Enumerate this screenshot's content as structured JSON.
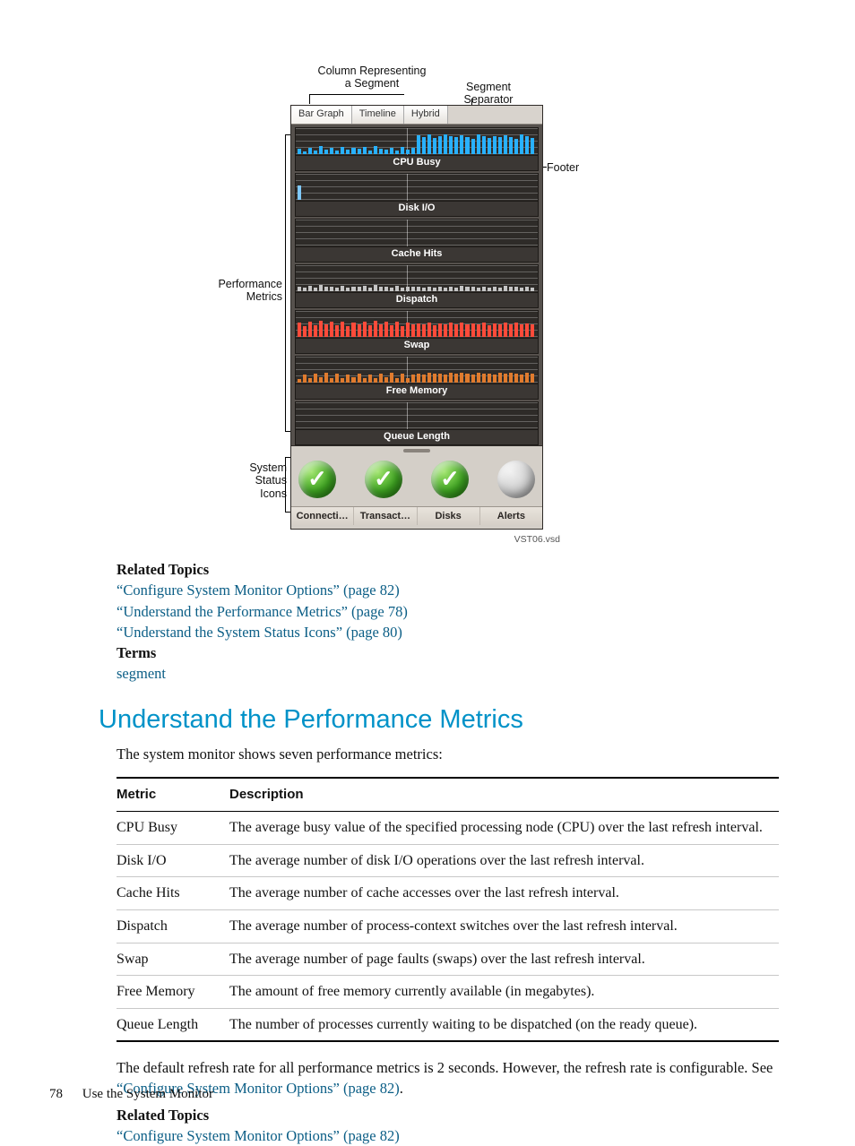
{
  "figure": {
    "labels": {
      "column_segment": "Column Representing\na Segment",
      "segment_separator": "Segment\nSeparator",
      "footer": "Footer",
      "performance_metrics": "Performance\nMetrics",
      "system_status_icons": "System\nStatus\nIcons",
      "vsd": "VST06.vsd"
    },
    "tabs": [
      "Bar Graph",
      "Timeline",
      "Hybrid"
    ],
    "metrics": [
      {
        "name": "CPU Busy",
        "color": "#29b1ff"
      },
      {
        "name": "Disk I/O",
        "color": "#7fc9ff"
      },
      {
        "name": "Cache Hits",
        "color": "#262626"
      },
      {
        "name": "Dispatch",
        "color": "#c6c6c6"
      },
      {
        "name": "Swap",
        "color": "#ff4b3a"
      },
      {
        "name": "Free Memory",
        "color": "#e07b2e"
      },
      {
        "name": "Queue Length",
        "color": "#262626"
      }
    ],
    "status": {
      "items": [
        {
          "label": "Connecti…",
          "state": "ok"
        },
        {
          "label": "Transact…",
          "state": "ok"
        },
        {
          "label": "Disks",
          "state": "ok"
        },
        {
          "label": "Alerts",
          "state": "idle"
        }
      ]
    }
  },
  "related1": {
    "heading": "Related Topics",
    "items": [
      "“Configure System Monitor Options” (page 82)",
      "“Understand the Performance Metrics” (page 78)",
      "“Understand the System Status Icons” (page 80)"
    ],
    "terms_heading": "Terms",
    "terms_link": "segment"
  },
  "section": {
    "title": "Understand the Performance Metrics",
    "intro": "The system monitor shows seven performance metrics:",
    "table": {
      "head": [
        "Metric",
        "Description"
      ],
      "rows": [
        [
          "CPU Busy",
          "The average busy value of the specified processing node (CPU) over the last refresh interval."
        ],
        [
          "Disk I/O",
          "The average number of disk I/O operations over the last refresh interval."
        ],
        [
          "Cache Hits",
          "The average number of cache accesses over the last refresh interval."
        ],
        [
          "Dispatch",
          "The average number of process-context switches over the last refresh interval."
        ],
        [
          "Swap",
          "The average number of page faults (swaps) over the last refresh interval."
        ],
        [
          "Free Memory",
          "The amount of free memory currently available (in megabytes)."
        ],
        [
          "Queue Length",
          "The number of processes currently waiting to be dispatched (on the ready queue)."
        ]
      ]
    },
    "paragraph_pre": "The default refresh rate for all performance metrics is 2 seconds. However, the refresh rate is configurable. See ",
    "paragraph_link": "“Configure System Monitor Options” (page 82)",
    "paragraph_post": "."
  },
  "related2": {
    "heading": "Related Topics",
    "items": [
      "“Configure System Monitor Options” (page 82)"
    ]
  },
  "footer": {
    "page": "78",
    "chapter": "Use the System Monitor"
  },
  "chart_data": {
    "type": "bar",
    "note": "Seven stacked per-metric bar strips; values are illustrative sparkline levels (0-100 scale) estimated from pixel heights, two segments separated by a vertical divider at ~46%.",
    "metrics": [
      {
        "name": "CPU Busy",
        "seg1": [
          20,
          10,
          25,
          12,
          30,
          18,
          22,
          14,
          28,
          16,
          24,
          19,
          26,
          15,
          30,
          20,
          18,
          22,
          14,
          28,
          16,
          24
        ],
        "seg2": [
          70,
          65,
          72,
          60,
          68,
          74,
          66,
          62,
          70,
          64,
          58,
          72,
          68,
          60,
          66,
          62,
          70,
          64,
          58,
          72,
          68,
          60
        ]
      },
      {
        "name": "Disk I/O",
        "seg1": [
          55,
          0,
          0,
          0,
          0,
          0,
          0,
          0,
          0,
          0,
          0,
          0,
          0,
          0,
          0,
          0,
          0,
          0,
          0,
          0,
          0,
          0
        ],
        "seg2": [
          0,
          0,
          0,
          0,
          0,
          0,
          0,
          0,
          0,
          0,
          0,
          0,
          0,
          0,
          0,
          0,
          0,
          0,
          0,
          0,
          0,
          0
        ]
      },
      {
        "name": "Cache Hits",
        "seg1": [
          0,
          0,
          0,
          0,
          0,
          0,
          0,
          0,
          0,
          0,
          0,
          0,
          0,
          0,
          0,
          0,
          0,
          0,
          0,
          0,
          0,
          0
        ],
        "seg2": [
          0,
          0,
          0,
          0,
          0,
          0,
          0,
          0,
          0,
          0,
          0,
          0,
          0,
          0,
          0,
          0,
          0,
          0,
          0,
          0,
          0,
          0
        ]
      },
      {
        "name": "Dispatch",
        "seg1": [
          18,
          12,
          20,
          14,
          22,
          16,
          18,
          14,
          20,
          12,
          18,
          16,
          20,
          14,
          22,
          16,
          18,
          14,
          20,
          12,
          18,
          16
        ],
        "seg2": [
          16,
          14,
          18,
          12,
          16,
          14,
          18,
          12,
          20,
          16,
          18,
          14,
          16,
          14,
          18,
          12,
          20,
          16,
          18,
          14,
          16,
          14
        ]
      },
      {
        "name": "Swap",
        "seg1": [
          55,
          40,
          58,
          42,
          60,
          46,
          56,
          44,
          58,
          40,
          54,
          46,
          58,
          42,
          60,
          46,
          56,
          44,
          58,
          40,
          54,
          46
        ],
        "seg2": [
          50,
          46,
          52,
          44,
          50,
          48,
          52,
          46,
          54,
          48,
          50,
          46,
          52,
          44,
          50,
          48,
          52,
          46,
          54,
          48,
          50,
          46
        ]
      },
      {
        "name": "Free Memory",
        "seg1": [
          14,
          30,
          18,
          34,
          20,
          36,
          16,
          32,
          18,
          30,
          20,
          34,
          16,
          30,
          18,
          34,
          20,
          36,
          16,
          32,
          18,
          30
        ],
        "seg2": [
          34,
          30,
          36,
          32,
          34,
          30,
          36,
          32,
          38,
          34,
          30,
          36,
          32,
          34,
          30,
          36,
          32,
          38,
          34,
          30,
          36,
          32
        ]
      },
      {
        "name": "Queue Length",
        "seg1": [
          0,
          0,
          0,
          0,
          0,
          0,
          0,
          0,
          0,
          0,
          0,
          0,
          0,
          0,
          0,
          0,
          0,
          0,
          0,
          0,
          0,
          0
        ],
        "seg2": [
          0,
          0,
          0,
          0,
          0,
          0,
          0,
          0,
          0,
          0,
          0,
          0,
          0,
          0,
          0,
          0,
          0,
          0,
          0,
          0,
          0,
          0
        ]
      }
    ]
  }
}
